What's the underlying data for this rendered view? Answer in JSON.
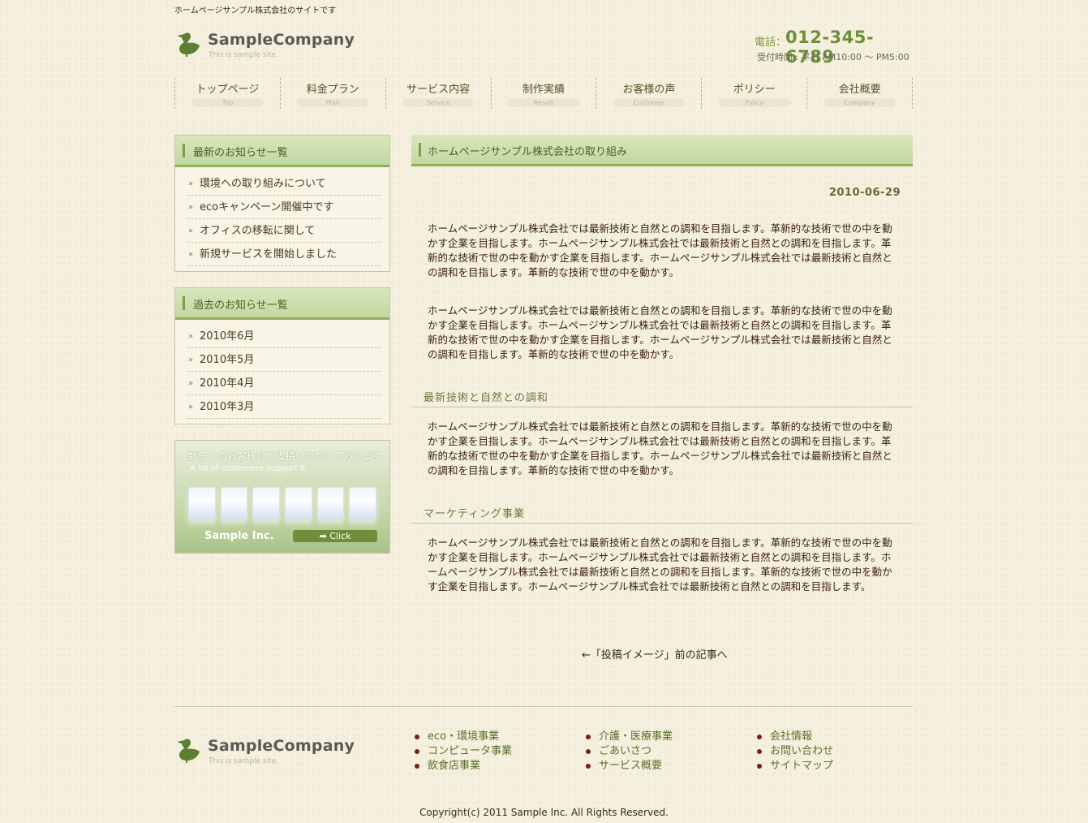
{
  "header": {
    "tagline": "ホームページサンプル株式会社のサイトです",
    "logo_name": "SampleCompany",
    "logo_sub": "This is sample site.",
    "phone_label": "電話：",
    "phone_number": "012-345-6789",
    "hours": "受付時間 : 平日 AM10:00 〜 PM5:00"
  },
  "nav": [
    {
      "jp": "トップページ",
      "en": "Top"
    },
    {
      "jp": "料金プラン",
      "en": "Plan"
    },
    {
      "jp": "サービス内容",
      "en": "Service"
    },
    {
      "jp": "制作実績",
      "en": "Result"
    },
    {
      "jp": "お客様の声",
      "en": "Customer"
    },
    {
      "jp": "ポリシー",
      "en": "Policy"
    },
    {
      "jp": "会社概要",
      "en": "Company"
    }
  ],
  "sidebar": {
    "latest_title": "最新のお知らせ一覧",
    "latest_items": [
      "環境への取り組みについて",
      "ecoキャンペーン開催中です",
      "オフィスの移転に関して",
      "新規サービスを開始しました"
    ],
    "past_title": "過去のお知らせ一覧",
    "past_items": [
      "2010年6月",
      "2010年5月",
      "2010年4月",
      "2010年3月"
    ],
    "chevron": "»",
    "banner": {
      "line1": "数多くのお客様にご支持いただいております",
      "line2": "A lot of customers support it",
      "brand": "Sample Inc.",
      "click": "➡ Click"
    }
  },
  "main": {
    "title": "ホームページサンプル株式会社の取り組み",
    "date": "2010-06-29",
    "p1": "ホームページサンプル株式会社では最新技術と自然との調和を目指します。革新的な技術で世の中を動かす企業を目指します。ホームページサンプル株式会社では最新技術と自然との調和を目指します。革新的な技術で世の中を動かす企業を目指します。ホームページサンプル株式会社では最新技術と自然との調和を目指します。革新的な技術で世の中を動かす。",
    "p2": "ホームページサンプル株式会社では最新技術と自然との調和を目指します。革新的な技術で世の中を動かす企業を目指します。ホームページサンプル株式会社では最新技術と自然との調和を目指します。革新的な技術で世の中を動かす企業を目指します。ホームページサンプル株式会社では最新技術と自然との調和を目指します。革新的な技術で世の中を動かす。",
    "h1": "最新技術と自然との調和",
    "p3": "ホームページサンプル株式会社では最新技術と自然との調和を目指します。革新的な技術で世の中を動かす企業を目指します。ホームページサンプル株式会社では最新技術と自然との調和を目指します。革新的な技術で世の中を動かす企業を目指します。ホームページサンプル株式会社では最新技術と自然との調和を目指します。革新的な技術で世の中を動かす。",
    "h2": "マーケティング事業",
    "p4": "ホームページサンプル株式会社では最新技術と自然との調和を目指します。革新的な技術で世の中を動かす企業を目指します。ホームページサンプル株式会社では最新技術と自然との調和を目指します。ホームページサンプル株式会社では最新技術と自然との調和を目指します。革新的な技術で世の中を動かす企業を目指します。ホームページサンプル株式会社では最新技術と自然との調和を目指します。",
    "prev_link": "←「投稿イメージ」前の記事へ"
  },
  "footer": {
    "col1": [
      "eco・環境事業",
      "コンピュータ事業",
      "飲食店事業"
    ],
    "col2": [
      "介護・医療事業",
      "ごあいさつ",
      "サービス概要"
    ],
    "col3": [
      "会社情報",
      "お問い合わせ",
      "サイトマップ"
    ],
    "copyright": "Copyright(c) 2011 Sample Inc. All Rights Reserved."
  },
  "colors": {
    "background": "#f6f1df",
    "accent_green": "#8faf5c",
    "bullet_red": "#7a1f14"
  }
}
